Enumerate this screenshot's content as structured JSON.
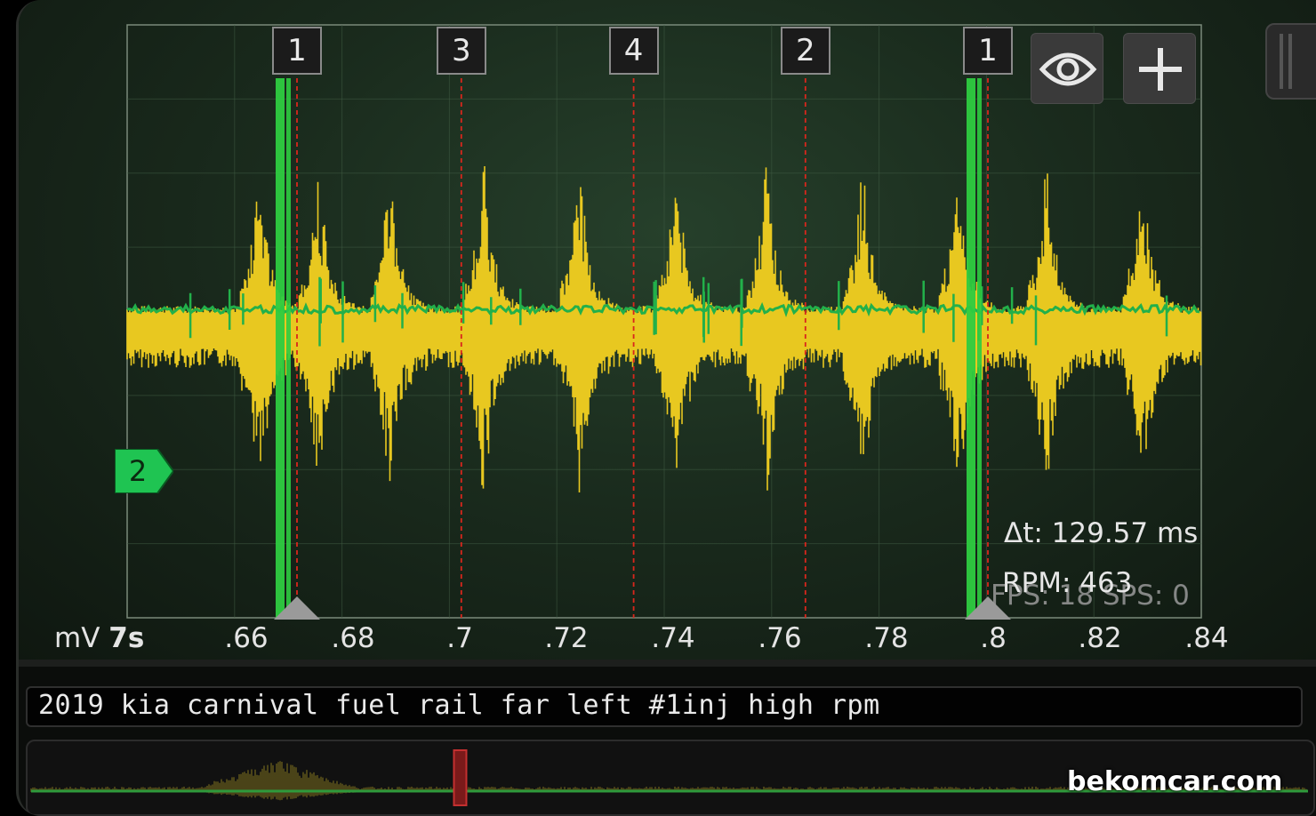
{
  "scope": {
    "unit": "mV",
    "timebase": "7s",
    "x_ticks": [
      ".66",
      ".68",
      ".7",
      ".72",
      ".74",
      ".76",
      ".78",
      ".8",
      ".82",
      ".84"
    ],
    "cylinder_markers": [
      {
        "label": "1",
        "x": 0.6695,
        "sync": true
      },
      {
        "label": "3",
        "x": 0.7003
      },
      {
        "label": "4",
        "x": 0.7326
      },
      {
        "label": "2",
        "x": 0.7648
      },
      {
        "label": "1",
        "x": 0.799,
        "sync": true
      }
    ],
    "cursor_x_range": [
      0.6695,
      0.799
    ],
    "delta_t": "Δt: 129.57 ms",
    "rpm": "RPM: 463",
    "fps": "FPS: 18",
    "sps": "SPS: 0",
    "channel_marker": "2",
    "buttons": {
      "eye": "eye-icon",
      "add": "plus-icon"
    },
    "colors": {
      "trace_yellow": "#e8c820",
      "trace_green": "#22b04a",
      "cursor_green": "#2ecc40",
      "marker_red": "#d9261c"
    }
  },
  "recording_title": "2019 kia carnival fuel rail far left #1inj high rpm",
  "overview": {
    "playhead_fraction": 0.336
  },
  "watermark": "bekomcar.com",
  "chart_data": {
    "type": "line",
    "title": "",
    "xlabel": "",
    "ylabel": "mV",
    "xlim": [
      0.65,
      0.84
    ],
    "x_ticks": [
      0.66,
      0.68,
      0.7,
      0.72,
      0.74,
      0.76,
      0.78,
      0.8,
      0.82,
      0.84
    ],
    "series": [
      {
        "name": "",
        "color": "#e8c820",
        "kind": "pressure-pulsation",
        "pulse_x": [
          0.6615,
          0.6725,
          0.686,
          0.7035,
          0.7215,
          0.7395,
          0.7565,
          0.7745,
          0.7925,
          0.809,
          0.827,
          0.842
        ]
      },
      {
        "name": "",
        "color": "#22b04a",
        "kind": "injector-signal",
        "pulse_x": [
          0.6695,
          0.799
        ]
      }
    ],
    "grid": true
  }
}
